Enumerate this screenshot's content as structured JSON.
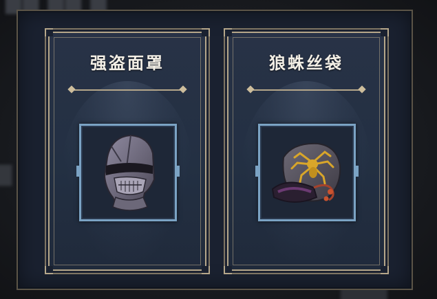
{
  "items": [
    {
      "name": "强盗面罩",
      "icon": "bandit-mask-icon"
    },
    {
      "name": "狼蛛丝袋",
      "icon": "tarantula-silk-bag-icon"
    }
  ],
  "colors": {
    "panel_bg": "#1a2130",
    "card_border": "#b6a78a",
    "item_frame": "#7ba3c4",
    "title_text": "#f3efe6"
  }
}
